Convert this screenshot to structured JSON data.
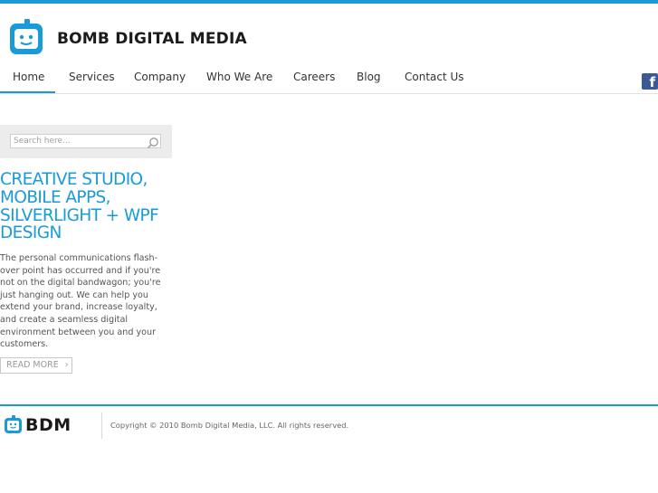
{
  "brand": {
    "name": "BOMB DIGITAL MEDIA",
    "short": "BDM",
    "accent_color": "#1a9bd7"
  },
  "nav": {
    "items": [
      {
        "label": "Home",
        "active": true
      },
      {
        "label": "Services"
      },
      {
        "label": "Company"
      },
      {
        "label": "Who We Are"
      },
      {
        "label": "Careers"
      },
      {
        "label": "Blog"
      },
      {
        "label": "Contact Us"
      }
    ],
    "social_icon": "facebook-icon",
    "social_glyph": "f"
  },
  "search": {
    "placeholder": "Search here...",
    "value": "",
    "icon": "search-icon"
  },
  "feature": {
    "headline_lines": [
      "CREATIVE STUDIO,",
      "MOBILE APPS,",
      "SILVERLIGHT + WPF",
      "DESIGN"
    ],
    "body": "The personal communications flash-over point has occurred and if you're not on the digital bandwagon; you're just hanging out. We can help you extend your brand, increase loyalty, and create a seamless digital environment between you and your customers.",
    "read_more_label": "READ MORE",
    "read_more_icon": "chevron-right-icon",
    "read_more_glyph": "›"
  },
  "footer": {
    "copyright": "Copyright © 2010 Bomb Digital Media, LLC. All rights reserved."
  }
}
